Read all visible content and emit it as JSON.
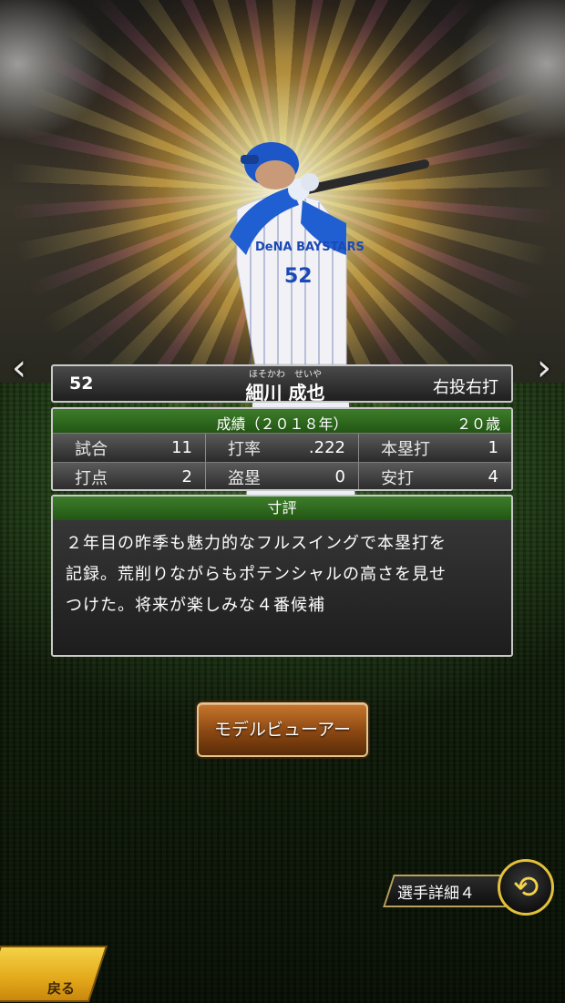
{
  "player": {
    "number": "52",
    "furigana": "ほそかわ　せいや",
    "name": "細川 成也",
    "throws_bats": "右投右打",
    "uniform_text": "DeNA BAYSTARS",
    "uniform_number": "52"
  },
  "stats": {
    "title": "成績（２０１８年）",
    "age": "２０歳",
    "rows": [
      [
        {
          "label": "試合",
          "value": "11"
        },
        {
          "label": "打率",
          "value": ".222"
        },
        {
          "label": "本塁打",
          "value": "1"
        }
      ],
      [
        {
          "label": "打点",
          "value": "2"
        },
        {
          "label": "盗塁",
          "value": "0"
        },
        {
          "label": "安打",
          "value": "4"
        }
      ]
    ]
  },
  "evaluation": {
    "title": "寸評",
    "lines": [
      "２年目の昨季も魅力的なフルスイングで本塁打を",
      "記録。荒削りながらもポテンシャルの高さを見せ",
      "つけた。将来が楽しみな４番候補"
    ]
  },
  "buttons": {
    "model_viewer": "モデルビューアー",
    "detail": "選手詳細４",
    "back": "戻る"
  },
  "nav": {
    "prev_icon": "chevron-left-icon",
    "next_icon": "chevron-right-icon"
  },
  "colors": {
    "header_green": "#2f6d1f",
    "button_brown": "#8a4712",
    "gold": "#e2c03a"
  }
}
